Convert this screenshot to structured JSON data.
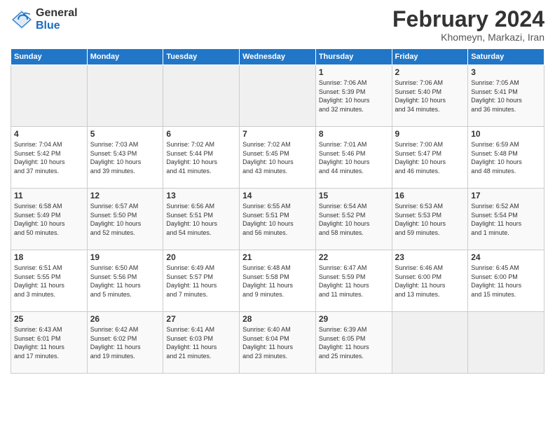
{
  "logo": {
    "general": "General",
    "blue": "Blue"
  },
  "calendar": {
    "title": "February 2024",
    "subtitle": "Khomeyn, Markazi, Iran"
  },
  "headers": [
    "Sunday",
    "Monday",
    "Tuesday",
    "Wednesday",
    "Thursday",
    "Friday",
    "Saturday"
  ],
  "weeks": [
    [
      {
        "day": "",
        "info": ""
      },
      {
        "day": "",
        "info": ""
      },
      {
        "day": "",
        "info": ""
      },
      {
        "day": "",
        "info": ""
      },
      {
        "day": "1",
        "info": "Sunrise: 7:06 AM\nSunset: 5:39 PM\nDaylight: 10 hours\nand 32 minutes."
      },
      {
        "day": "2",
        "info": "Sunrise: 7:06 AM\nSunset: 5:40 PM\nDaylight: 10 hours\nand 34 minutes."
      },
      {
        "day": "3",
        "info": "Sunrise: 7:05 AM\nSunset: 5:41 PM\nDaylight: 10 hours\nand 36 minutes."
      }
    ],
    [
      {
        "day": "4",
        "info": "Sunrise: 7:04 AM\nSunset: 5:42 PM\nDaylight: 10 hours\nand 37 minutes."
      },
      {
        "day": "5",
        "info": "Sunrise: 7:03 AM\nSunset: 5:43 PM\nDaylight: 10 hours\nand 39 minutes."
      },
      {
        "day": "6",
        "info": "Sunrise: 7:02 AM\nSunset: 5:44 PM\nDaylight: 10 hours\nand 41 minutes."
      },
      {
        "day": "7",
        "info": "Sunrise: 7:02 AM\nSunset: 5:45 PM\nDaylight: 10 hours\nand 43 minutes."
      },
      {
        "day": "8",
        "info": "Sunrise: 7:01 AM\nSunset: 5:46 PM\nDaylight: 10 hours\nand 44 minutes."
      },
      {
        "day": "9",
        "info": "Sunrise: 7:00 AM\nSunset: 5:47 PM\nDaylight: 10 hours\nand 46 minutes."
      },
      {
        "day": "10",
        "info": "Sunrise: 6:59 AM\nSunset: 5:48 PM\nDaylight: 10 hours\nand 48 minutes."
      }
    ],
    [
      {
        "day": "11",
        "info": "Sunrise: 6:58 AM\nSunset: 5:49 PM\nDaylight: 10 hours\nand 50 minutes."
      },
      {
        "day": "12",
        "info": "Sunrise: 6:57 AM\nSunset: 5:50 PM\nDaylight: 10 hours\nand 52 minutes."
      },
      {
        "day": "13",
        "info": "Sunrise: 6:56 AM\nSunset: 5:51 PM\nDaylight: 10 hours\nand 54 minutes."
      },
      {
        "day": "14",
        "info": "Sunrise: 6:55 AM\nSunset: 5:51 PM\nDaylight: 10 hours\nand 56 minutes."
      },
      {
        "day": "15",
        "info": "Sunrise: 6:54 AM\nSunset: 5:52 PM\nDaylight: 10 hours\nand 58 minutes."
      },
      {
        "day": "16",
        "info": "Sunrise: 6:53 AM\nSunset: 5:53 PM\nDaylight: 10 hours\nand 59 minutes."
      },
      {
        "day": "17",
        "info": "Sunrise: 6:52 AM\nSunset: 5:54 PM\nDaylight: 11 hours\nand 1 minute."
      }
    ],
    [
      {
        "day": "18",
        "info": "Sunrise: 6:51 AM\nSunset: 5:55 PM\nDaylight: 11 hours\nand 3 minutes."
      },
      {
        "day": "19",
        "info": "Sunrise: 6:50 AM\nSunset: 5:56 PM\nDaylight: 11 hours\nand 5 minutes."
      },
      {
        "day": "20",
        "info": "Sunrise: 6:49 AM\nSunset: 5:57 PM\nDaylight: 11 hours\nand 7 minutes."
      },
      {
        "day": "21",
        "info": "Sunrise: 6:48 AM\nSunset: 5:58 PM\nDaylight: 11 hours\nand 9 minutes."
      },
      {
        "day": "22",
        "info": "Sunrise: 6:47 AM\nSunset: 5:59 PM\nDaylight: 11 hours\nand 11 minutes."
      },
      {
        "day": "23",
        "info": "Sunrise: 6:46 AM\nSunset: 6:00 PM\nDaylight: 11 hours\nand 13 minutes."
      },
      {
        "day": "24",
        "info": "Sunrise: 6:45 AM\nSunset: 6:00 PM\nDaylight: 11 hours\nand 15 minutes."
      }
    ],
    [
      {
        "day": "25",
        "info": "Sunrise: 6:43 AM\nSunset: 6:01 PM\nDaylight: 11 hours\nand 17 minutes."
      },
      {
        "day": "26",
        "info": "Sunrise: 6:42 AM\nSunset: 6:02 PM\nDaylight: 11 hours\nand 19 minutes."
      },
      {
        "day": "27",
        "info": "Sunrise: 6:41 AM\nSunset: 6:03 PM\nDaylight: 11 hours\nand 21 minutes."
      },
      {
        "day": "28",
        "info": "Sunrise: 6:40 AM\nSunset: 6:04 PM\nDaylight: 11 hours\nand 23 minutes."
      },
      {
        "day": "29",
        "info": "Sunrise: 6:39 AM\nSunset: 6:05 PM\nDaylight: 11 hours\nand 25 minutes."
      },
      {
        "day": "",
        "info": ""
      },
      {
        "day": "",
        "info": ""
      }
    ]
  ]
}
